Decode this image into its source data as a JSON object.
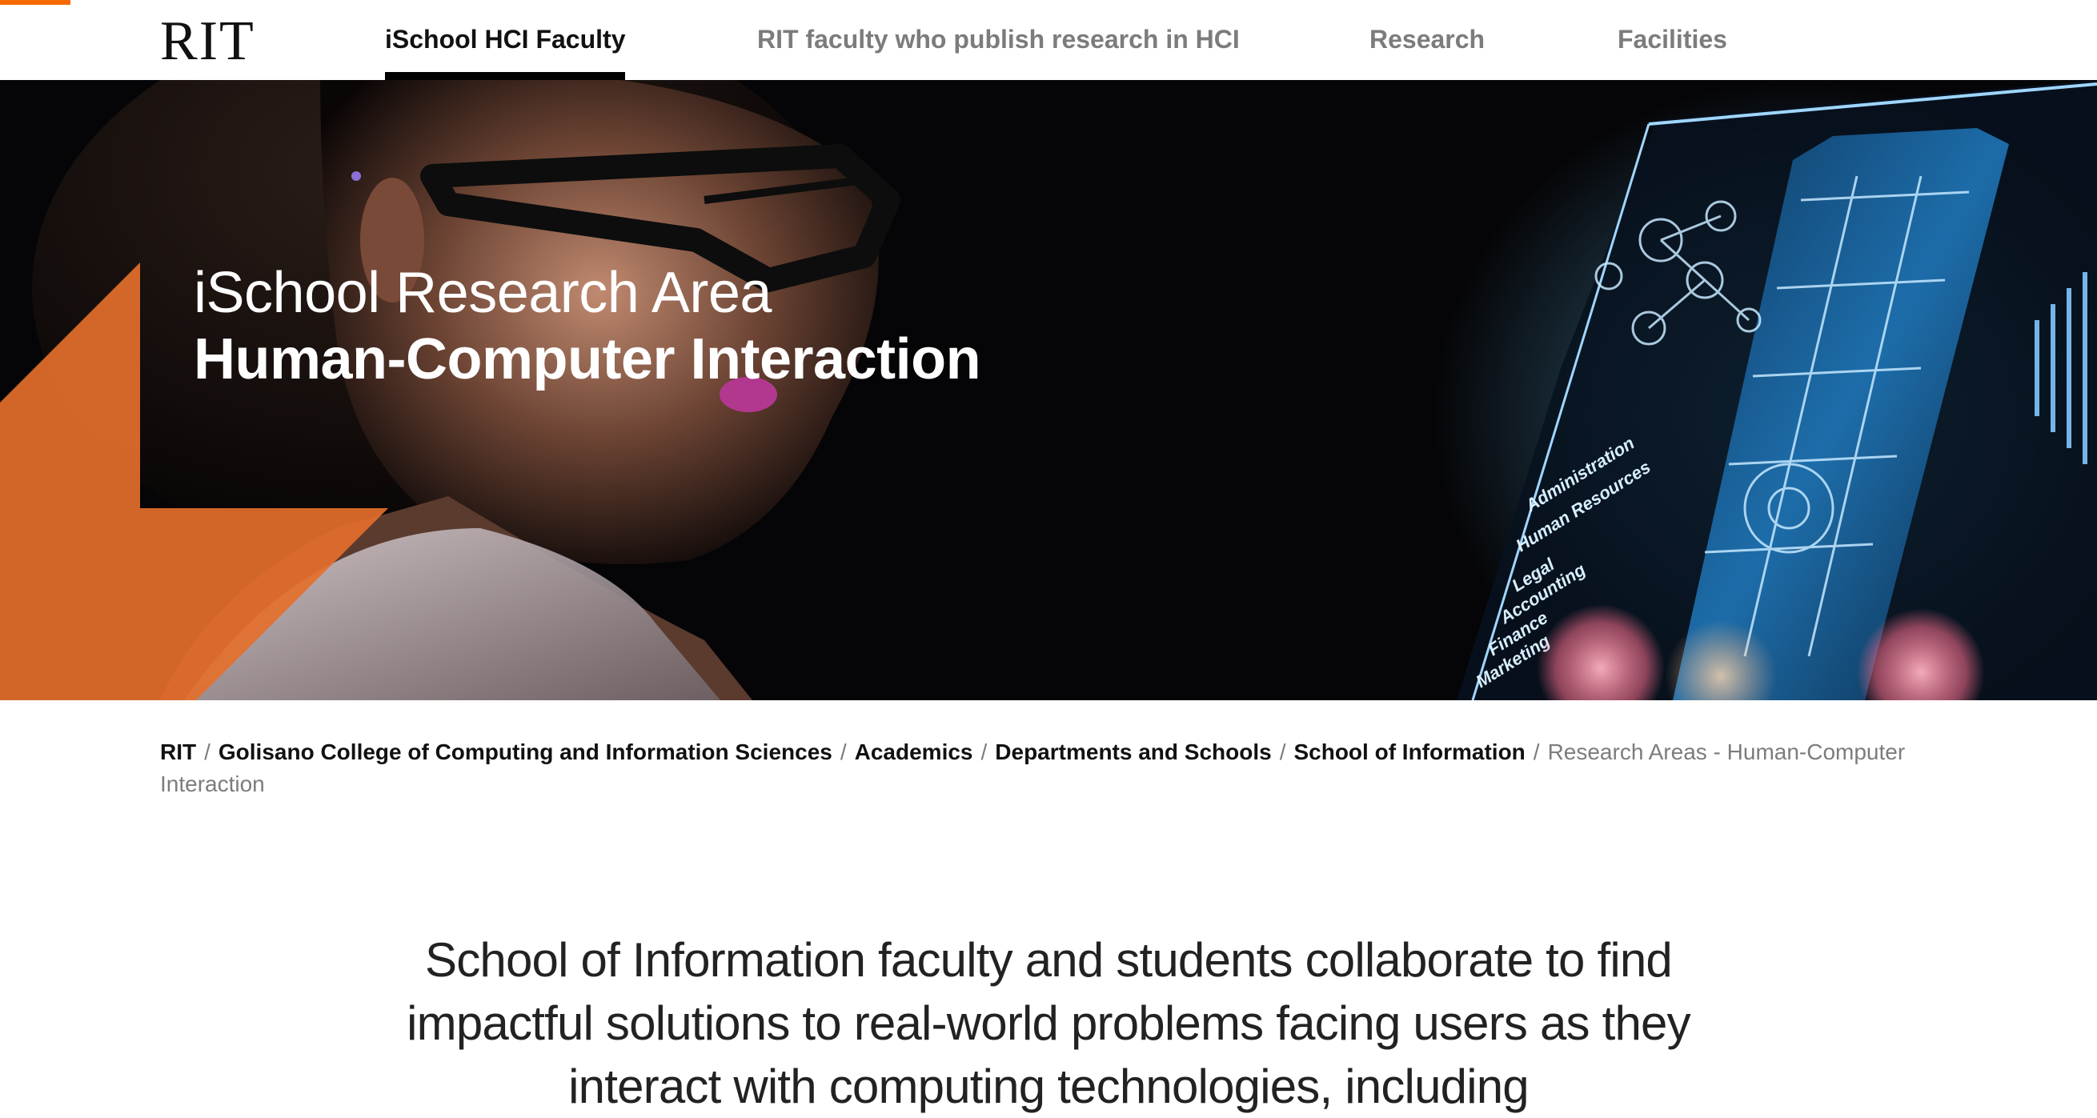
{
  "brand": {
    "logo_text": "RIT",
    "accent_color": "#f76902"
  },
  "nav": {
    "items": [
      {
        "label": "iSchool HCI Faculty",
        "active": true
      },
      {
        "label": "RIT faculty who publish research in HCI",
        "active": false
      },
      {
        "label": "Research",
        "active": false
      },
      {
        "label": "Facilities",
        "active": false
      }
    ]
  },
  "hero": {
    "eyebrow": "iSchool Research Area",
    "title": "Human-Computer Interaction",
    "screen_menu": [
      "Administration",
      "Human Resources",
      "Legal",
      "Accounting",
      "Finance",
      "Marketing"
    ]
  },
  "breadcrumb": {
    "links": [
      "RIT",
      "Golisano College of Computing and Information Sciences",
      "Academics",
      "Departments and Schools",
      "School of Information"
    ],
    "current": "Research Areas - Human-Computer Interaction",
    "separator": "/"
  },
  "intro": {
    "text": "School of Information faculty and students collaborate to find impactful solutions to real-world problems facing users as they interact with computing technologies, including"
  }
}
